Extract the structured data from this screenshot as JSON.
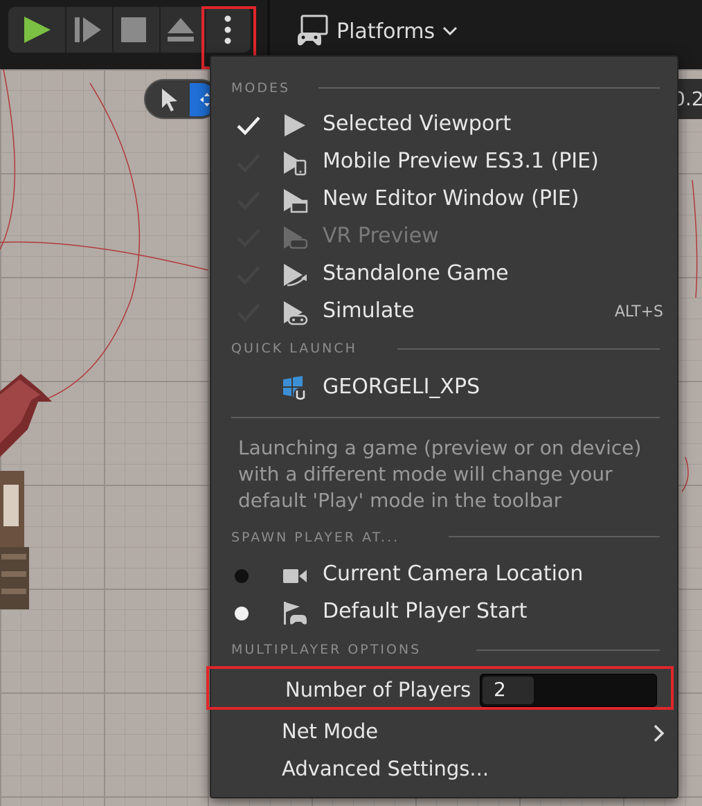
{
  "toolbar": {
    "platforms_label": "Platforms",
    "accent_play": "#7bc043",
    "icons": [
      "play-icon",
      "frame-skip-icon",
      "stop-icon",
      "eject-icon",
      "more-options-icon",
      "platforms-icon",
      "chevron-down-icon"
    ]
  },
  "viewport": {
    "readout_fragment": "0.2"
  },
  "menu": {
    "modes_header": "MODES",
    "modes": [
      {
        "label": "Selected Viewport",
        "checked": true,
        "icon": "play-triangle-icon",
        "enabled": true
      },
      {
        "label": "Mobile Preview ES3.1 (PIE)",
        "checked": false,
        "icon": "mobile-preview-icon",
        "enabled": true
      },
      {
        "label": "New Editor Window (PIE)",
        "checked": false,
        "icon": "editor-window-icon",
        "enabled": true
      },
      {
        "label": "VR Preview",
        "checked": false,
        "icon": "vr-preview-icon",
        "enabled": false
      },
      {
        "label": "Standalone Game",
        "checked": false,
        "icon": "standalone-game-icon",
        "enabled": true
      },
      {
        "label": "Simulate",
        "checked": false,
        "icon": "simulate-icon",
        "enabled": true,
        "shortcut": "ALT+S"
      }
    ],
    "quick_launch_header": "QUICK LAUNCH",
    "quick_launch_item": "GEORGELI_XPS",
    "info_text": "Launching a game (preview or on device) with a different mode will change your default 'Play' mode in the toolbar",
    "spawn_header": "SPAWN PLAYER AT...",
    "spawn_options": [
      {
        "label": "Current Camera Location",
        "selected": false,
        "icon": "camera-icon"
      },
      {
        "label": "Default Player Start",
        "selected": true,
        "icon": "player-start-flag-icon"
      }
    ],
    "multiplayer_header": "MULTIPLAYER OPTIONS",
    "number_of_players_label": "Number of Players",
    "number_of_players_value": "2",
    "net_mode_label": "Net Mode",
    "advanced_settings_label": "Advanced Settings..."
  }
}
